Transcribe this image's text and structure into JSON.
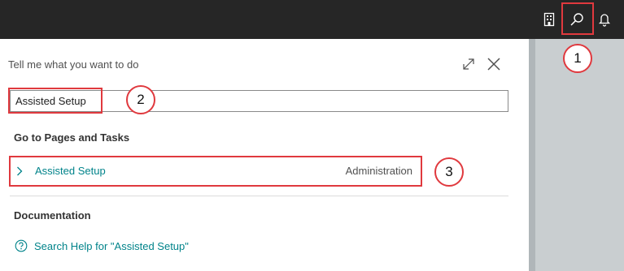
{
  "topbar": {
    "icons": [
      {
        "name": "company-icon"
      },
      {
        "name": "search-icon"
      },
      {
        "name": "bell-icon"
      }
    ]
  },
  "panel": {
    "title": "Tell me what you want to do",
    "search_value": "Assisted Setup",
    "sections": {
      "goto_heading": "Go to Pages and Tasks",
      "documentation_heading": "Documentation"
    },
    "result": {
      "label": "Assisted Setup",
      "category": "Administration"
    },
    "help_link": "Search Help for \"Assisted Setup\""
  },
  "callouts": [
    "1",
    "2",
    "3"
  ],
  "colors": {
    "topbar": "#262626",
    "accent": "#00838a",
    "callout": "#e0393e",
    "backdrop": "#c9ced0"
  }
}
